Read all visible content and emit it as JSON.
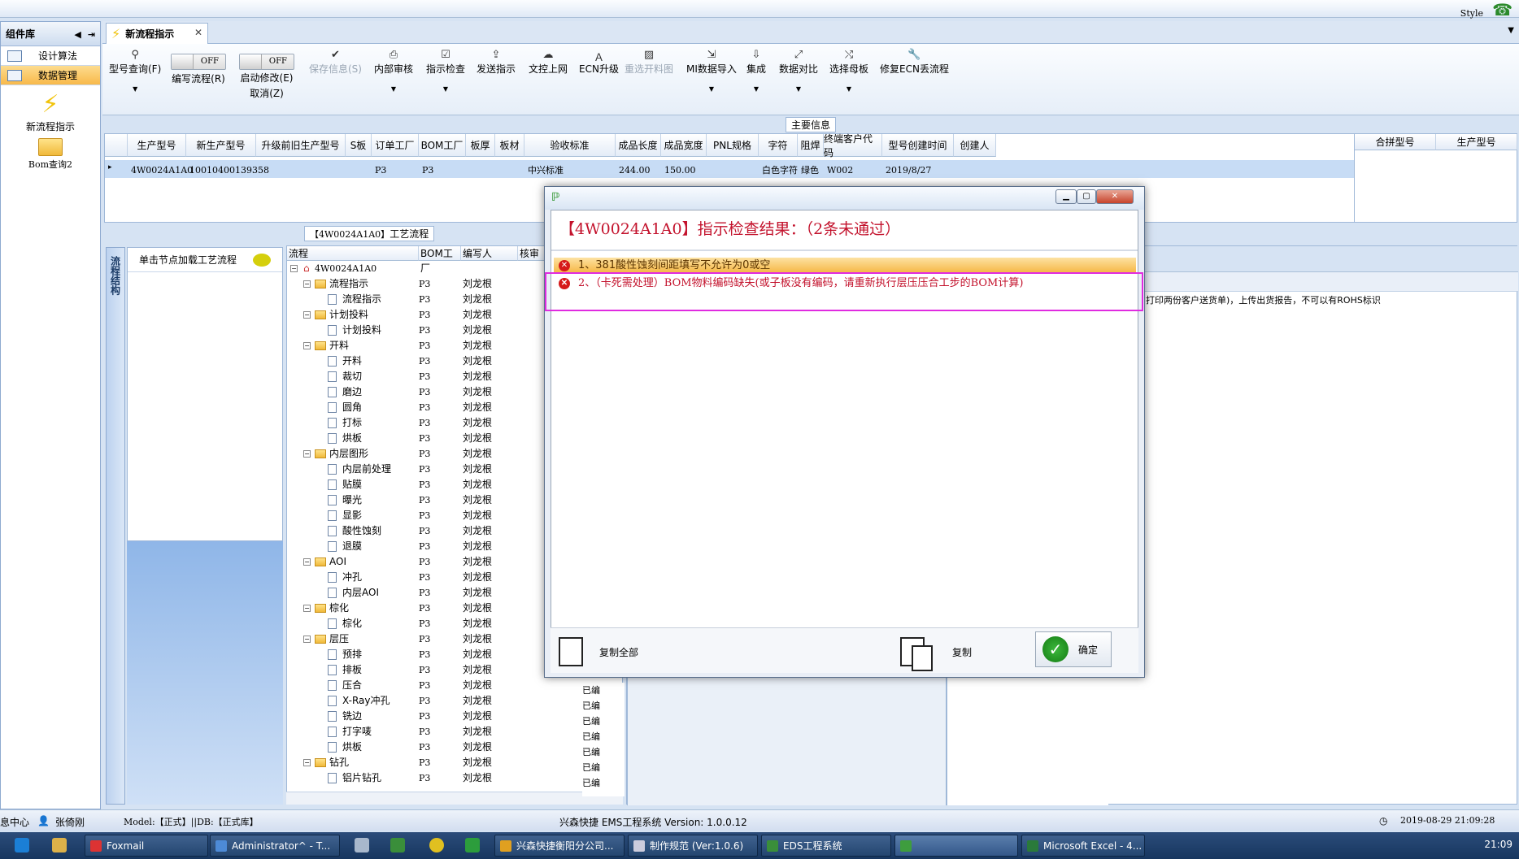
{
  "topbar": {
    "style_label": "Style"
  },
  "leftpanel": {
    "title": "组件库",
    "items": [
      {
        "label": "设计算法",
        "active": false
      },
      {
        "label": "数据管理",
        "active": true
      }
    ],
    "big_items": [
      {
        "label": "新流程指示",
        "icon": "lightning-icon"
      },
      {
        "label": "Bom查询2",
        "icon": "folder-icon"
      }
    ]
  },
  "tab": {
    "label": "新流程指示"
  },
  "toolbar": {
    "model_query": "型号查询(F)",
    "edit_flow_toggle": "OFF",
    "edit_flow": "编写流程(R)",
    "start_modify_toggle": "OFF",
    "start_modify": "启动修改(E)",
    "cancel": "取消(Z)",
    "save_info": "保存信息(S)",
    "internal_review": "内部审核",
    "instruction_check": "指示检查",
    "send_instruction": "发送指示",
    "upload_doc": "文控上网",
    "ecn_upgrade": "ECN升级",
    "reselect_cut": "重选开料图",
    "mi_import": "MI数据导入",
    "integrate": "集成",
    "data_compare": "数据对比",
    "select_master": "选择母板",
    "fix_ecn": "修复ECN丢流程"
  },
  "main_info": {
    "title": "主要信息",
    "columns": [
      "生产型号",
      "新生产型号",
      "升级前旧生产型号",
      "S板",
      "订单工厂",
      "BOM工厂",
      "板厚",
      "板材",
      "验收标准",
      "成品长度",
      "成品宽度",
      "PNL规格",
      "字符",
      "阻焊",
      "终端客户代码",
      "型号创建时间",
      "创建人"
    ],
    "row": [
      "4W0024A1A0",
      "10010400139358",
      "",
      "",
      "P3",
      "P3",
      "",
      "",
      "中兴标准",
      "244.00",
      "150.00",
      "",
      "白色字符",
      "绿色",
      "W002",
      "2019/8/27",
      ""
    ],
    "side_columns": [
      "合拼型号",
      "生产型号"
    ]
  },
  "flow": {
    "title_prefix": "【4W0024A1A0】",
    "title_suffix": "工艺流程",
    "vtab_label": "流程结构",
    "node_hint": "单击节点加载工艺流程",
    "columns": [
      "流程",
      "BOM工厂",
      "编写人",
      "核审"
    ],
    "root": "4W0024A1A0",
    "rows": [
      {
        "label": "流程指示",
        "level": 1,
        "bom": "P3",
        "writer": "刘龙根"
      },
      {
        "label": "流程指示",
        "level": 2,
        "bom": "P3",
        "writer": "刘龙根"
      },
      {
        "label": "计划投料",
        "level": 1,
        "bom": "P3",
        "writer": "刘龙根"
      },
      {
        "label": "计划投料",
        "level": 2,
        "bom": "P3",
        "writer": "刘龙根"
      },
      {
        "label": "开料",
        "level": 1,
        "bom": "P3",
        "writer": "刘龙根"
      },
      {
        "label": "开料",
        "level": 2,
        "bom": "P3",
        "writer": "刘龙根"
      },
      {
        "label": "裁切",
        "level": 2,
        "bom": "P3",
        "writer": "刘龙根"
      },
      {
        "label": "磨边",
        "level": 2,
        "bom": "P3",
        "writer": "刘龙根"
      },
      {
        "label": "圆角",
        "level": 2,
        "bom": "P3",
        "writer": "刘龙根"
      },
      {
        "label": "打标",
        "level": 2,
        "bom": "P3",
        "writer": "刘龙根"
      },
      {
        "label": "烘板",
        "level": 2,
        "bom": "P3",
        "writer": "刘龙根"
      },
      {
        "label": "内层图形",
        "level": 1,
        "bom": "P3",
        "writer": "刘龙根"
      },
      {
        "label": "内层前处理",
        "level": 2,
        "bom": "P3",
        "writer": "刘龙根"
      },
      {
        "label": "贴膜",
        "level": 2,
        "bom": "P3",
        "writer": "刘龙根"
      },
      {
        "label": "曝光",
        "level": 2,
        "bom": "P3",
        "writer": "刘龙根"
      },
      {
        "label": "显影",
        "level": 2,
        "bom": "P3",
        "writer": "刘龙根"
      },
      {
        "label": "酸性蚀刻",
        "level": 2,
        "bom": "P3",
        "writer": "刘龙根"
      },
      {
        "label": "退膜",
        "level": 2,
        "bom": "P3",
        "writer": "刘龙根"
      },
      {
        "label": "AOI",
        "level": 1,
        "bom": "P3",
        "writer": "刘龙根"
      },
      {
        "label": "冲孔",
        "level": 2,
        "bom": "P3",
        "writer": "刘龙根"
      },
      {
        "label": "内层AOI",
        "level": 2,
        "bom": "P3",
        "writer": "刘龙根"
      },
      {
        "label": "棕化",
        "level": 1,
        "bom": "P3",
        "writer": "刘龙根"
      },
      {
        "label": "棕化",
        "level": 2,
        "bom": "P3",
        "writer": "刘龙根"
      },
      {
        "label": "层压",
        "level": 1,
        "bom": "P3",
        "writer": "刘龙根"
      },
      {
        "label": "预排",
        "level": 2,
        "bom": "P3",
        "writer": "刘龙根"
      },
      {
        "label": "排板",
        "level": 2,
        "bom": "P3",
        "writer": "刘龙根"
      },
      {
        "label": "压合",
        "level": 2,
        "bom": "P3",
        "writer": "刘龙根"
      },
      {
        "label": "X-Ray冲孔",
        "level": 2,
        "bom": "P3",
        "writer": "刘龙根"
      },
      {
        "label": "铣边",
        "level": 2,
        "bom": "P3",
        "writer": "刘龙根"
      },
      {
        "label": "打字唛",
        "level": 2,
        "bom": "P3",
        "writer": "刘龙根"
      },
      {
        "label": "烘板",
        "level": 2,
        "bom": "P3",
        "writer": "刘龙根"
      },
      {
        "label": "钻孔",
        "level": 1,
        "bom": "P3",
        "writer": "刘龙根"
      },
      {
        "label": "铝片钻孔",
        "level": 2,
        "bom": "P3",
        "writer": "刘龙根"
      }
    ],
    "status_label": "已编"
  },
  "right_text": "打印两份客户送货单)，上传出货报告，不可以有ROHS标识",
  "dialog": {
    "title": "【4W0024A1A0】指示检查结果：（2条未通过）",
    "issues": [
      "1、381酸性蚀刻间距填写不允许为0或空",
      "2、（卡死需处理）BOM物料编码缺失(或子板没有编码，请重新执行层压压合工步的BOM计算)"
    ],
    "copy_all": "复制全部",
    "copy": "复制",
    "ok": "确定"
  },
  "statusbar": {
    "center": "息中心",
    "user": "张倚刚",
    "model": "Model:【正式】||DB:【正式库】",
    "system": "兴森快捷 EMS工程系统 Version: 1.0.0.12",
    "datetime": "2019-08-29 21:09:28"
  },
  "taskbar": {
    "tasks": [
      "Foxmail",
      "Administrator^ - T...",
      "兴森快捷衡阳分公司...",
      "制作规范 (Ver:1.0.6)",
      "EDS工程系统",
      "Microsoft Excel - 4..."
    ],
    "time": "21:09"
  }
}
